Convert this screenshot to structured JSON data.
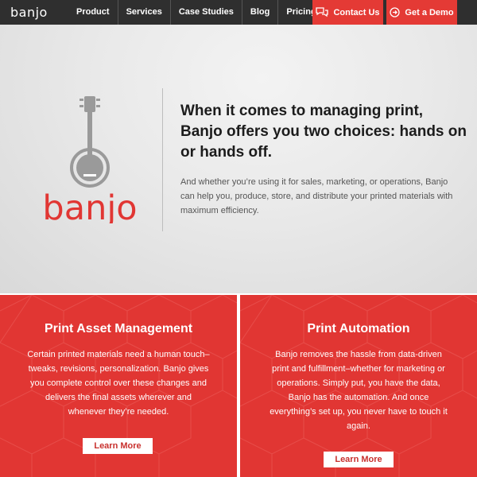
{
  "nav": {
    "logo": "banjo",
    "links": [
      "Product",
      "Services",
      "Case Studies",
      "Blog",
      "Pricing"
    ],
    "contact_label": "Contact Us",
    "demo_label": "Get a Demo"
  },
  "hero": {
    "logo_word": "banjo",
    "title": "When it comes to managing print, Banjo offers you two choices: hands on or hands off.",
    "subtitle": "And whether you’re using it for sales, marketing, or operations, Banjo can help you, produce, store, and distribute your printed materials with maximum efficiency."
  },
  "panels": [
    {
      "title": "Print Asset Management",
      "body": "Certain printed materials need a human touch–tweaks, revisions, personalization. Banjo gives you complete control over these changes and delivers the final assets wherever and whenever they’re needed.",
      "button": "Learn More"
    },
    {
      "title": "Print Automation",
      "body": "Banjo removes the hassle from data-driven print and fulfillment–whether for marketing or operations. Simply put, you have the data, Banjo has the automation. And once everything’s set up, you never have to touch it again.",
      "button": "Learn More"
    }
  ],
  "colors": {
    "nav_bg": "#2f2f2f",
    "accent_red": "#e13633",
    "logo_gray": "#9a9a9a"
  }
}
